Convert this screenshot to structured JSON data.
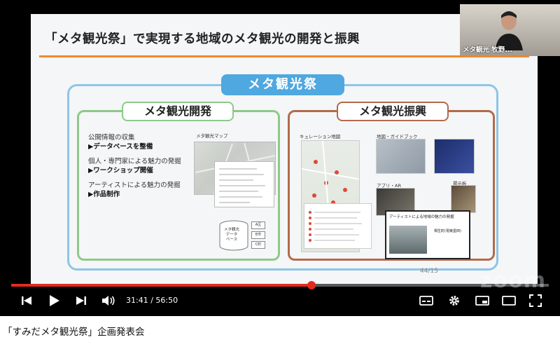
{
  "slide": {
    "title": "「メタ観光祭」で実現する地域のメタ観光の開発と振興",
    "main_badge": "メタ観光祭",
    "development": {
      "badge": "メタ観光開発",
      "items": [
        {
          "text": "公開情報の収集",
          "sub": "▶データベースを整備"
        },
        {
          "text": "個人・専門家による魅力の発掘",
          "sub": "▶ワークショップ開催"
        },
        {
          "text": "アーティストによる魅力の発掘",
          "sub": "▶作品制作"
        }
      ],
      "map_label": "メタ観光マップ",
      "db_label": "メタ観光\nデータ\nベース",
      "db_tags": [
        "A区",
        "B市",
        "C町"
      ]
    },
    "promotion": {
      "badge": "メタ観光振興",
      "curation_label": "キュレーション地図",
      "guide_label": "地図・ガイドブック",
      "app_label": "アプリ・AR",
      "board_label": "掲示板",
      "artist_doc_title": "アーティストによる地域の魅力の発掘",
      "artist_doc_name": "相生町(現東墨田)"
    },
    "page_label": "44/15"
  },
  "zoom_logo": "zoom",
  "participant": {
    "name": "メタ観光 牧野..."
  },
  "player": {
    "progress_fraction": 0.558,
    "time_current": "31:41",
    "time_separator": " / ",
    "time_total": "56:50",
    "accent": "#e42a1d"
  },
  "video_title": "「すみだメタ観光祭」企画発表会"
}
